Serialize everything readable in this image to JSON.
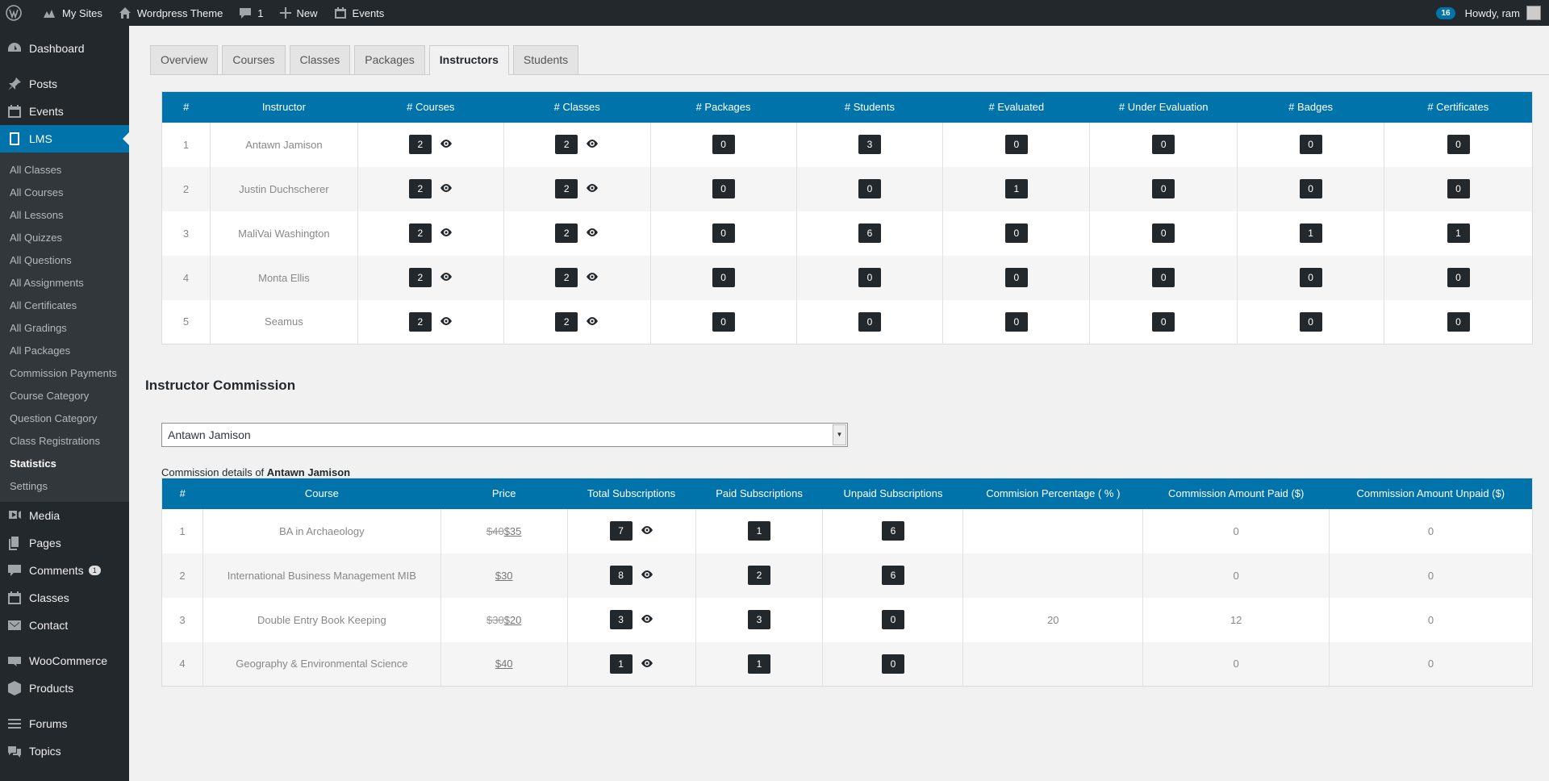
{
  "adminbar": {
    "my_sites": "My Sites",
    "site_name": "Wordpress Theme",
    "comments_count": "1",
    "new_label": "New",
    "events_label": "Events",
    "updates_count": "16",
    "howdy": "Howdy, ram"
  },
  "sidebar": {
    "dashboard": "Dashboard",
    "posts": "Posts",
    "events": "Events",
    "lms": "LMS",
    "lms_items": [
      "All Classes",
      "All Courses",
      "All Lessons",
      "All Quizzes",
      "All Questions",
      "All Assignments",
      "All Certificates",
      "All Gradings",
      "All Packages",
      "Commission Payments",
      "Course Category",
      "Question Category",
      "Class Registrations",
      "Statistics",
      "Settings"
    ],
    "media": "Media",
    "pages": "Pages",
    "comments": "Comments",
    "comments_badge": "1",
    "classes": "Classes",
    "contact": "Contact",
    "woocommerce": "WooCommerce",
    "products": "Products",
    "forums": "Forums",
    "topics": "Topics"
  },
  "tabs": [
    "Overview",
    "Courses",
    "Classes",
    "Packages",
    "Instructors",
    "Students"
  ],
  "instructors_table": {
    "headers": [
      "#",
      "Instructor",
      "# Courses",
      "# Classes",
      "# Packages",
      "# Students",
      "# Evaluated",
      "# Under Evaluation",
      "# Badges",
      "# Certificates"
    ],
    "rows": [
      [
        "1",
        "Antawn Jamison",
        "2",
        "2",
        "0",
        "3",
        "0",
        "0",
        "0",
        "0"
      ],
      [
        "2",
        "Justin Duchscherer",
        "2",
        "2",
        "0",
        "0",
        "1",
        "0",
        "0",
        "0"
      ],
      [
        "3",
        "MaliVai Washington",
        "2",
        "2",
        "0",
        "6",
        "0",
        "0",
        "1",
        "1"
      ],
      [
        "4",
        "Monta Ellis",
        "2",
        "2",
        "0",
        "0",
        "0",
        "0",
        "0",
        "0"
      ],
      [
        "5",
        "Seamus",
        "2",
        "2",
        "0",
        "0",
        "0",
        "0",
        "0",
        "0"
      ]
    ]
  },
  "commission": {
    "title": "Instructor Commission",
    "selected_instructor": "Antawn Jamison",
    "details_prefix": "Commission details of",
    "details_name": "Antawn Jamison",
    "headers": [
      "#",
      "Course",
      "Price",
      "Total Subscriptions",
      "Paid Subscriptions",
      "Unpaid Subscriptions",
      "Commision Percentage ( % )",
      "Commission Amount Paid ($)",
      "Commission Amount Unpaid ($)"
    ],
    "rows": [
      {
        "n": "1",
        "course": "BA in Archaeology",
        "old_price": "$40",
        "price": "$35",
        "total": "7",
        "paid": "1",
        "unpaid": "6",
        "pct": "",
        "amt_paid": "0",
        "amt_unpaid": "0"
      },
      {
        "n": "2",
        "course": "International Business Management MIB",
        "old_price": "",
        "price": "$30",
        "total": "8",
        "paid": "2",
        "unpaid": "6",
        "pct": "",
        "amt_paid": "0",
        "amt_unpaid": "0"
      },
      {
        "n": "3",
        "course": "Double Entry Book Keeping",
        "old_price": "$30",
        "price": "$20",
        "total": "3",
        "paid": "3",
        "unpaid": "0",
        "pct": "20",
        "amt_paid": "12",
        "amt_unpaid": "0"
      },
      {
        "n": "4",
        "course": "Geography & Environmental Science",
        "old_price": "",
        "price": "$40",
        "total": "1",
        "paid": "1",
        "unpaid": "0",
        "pct": "",
        "amt_paid": "0",
        "amt_unpaid": "0"
      }
    ]
  },
  "colors": {
    "accent": "#0073aa",
    "adminbar": "#23282d"
  }
}
